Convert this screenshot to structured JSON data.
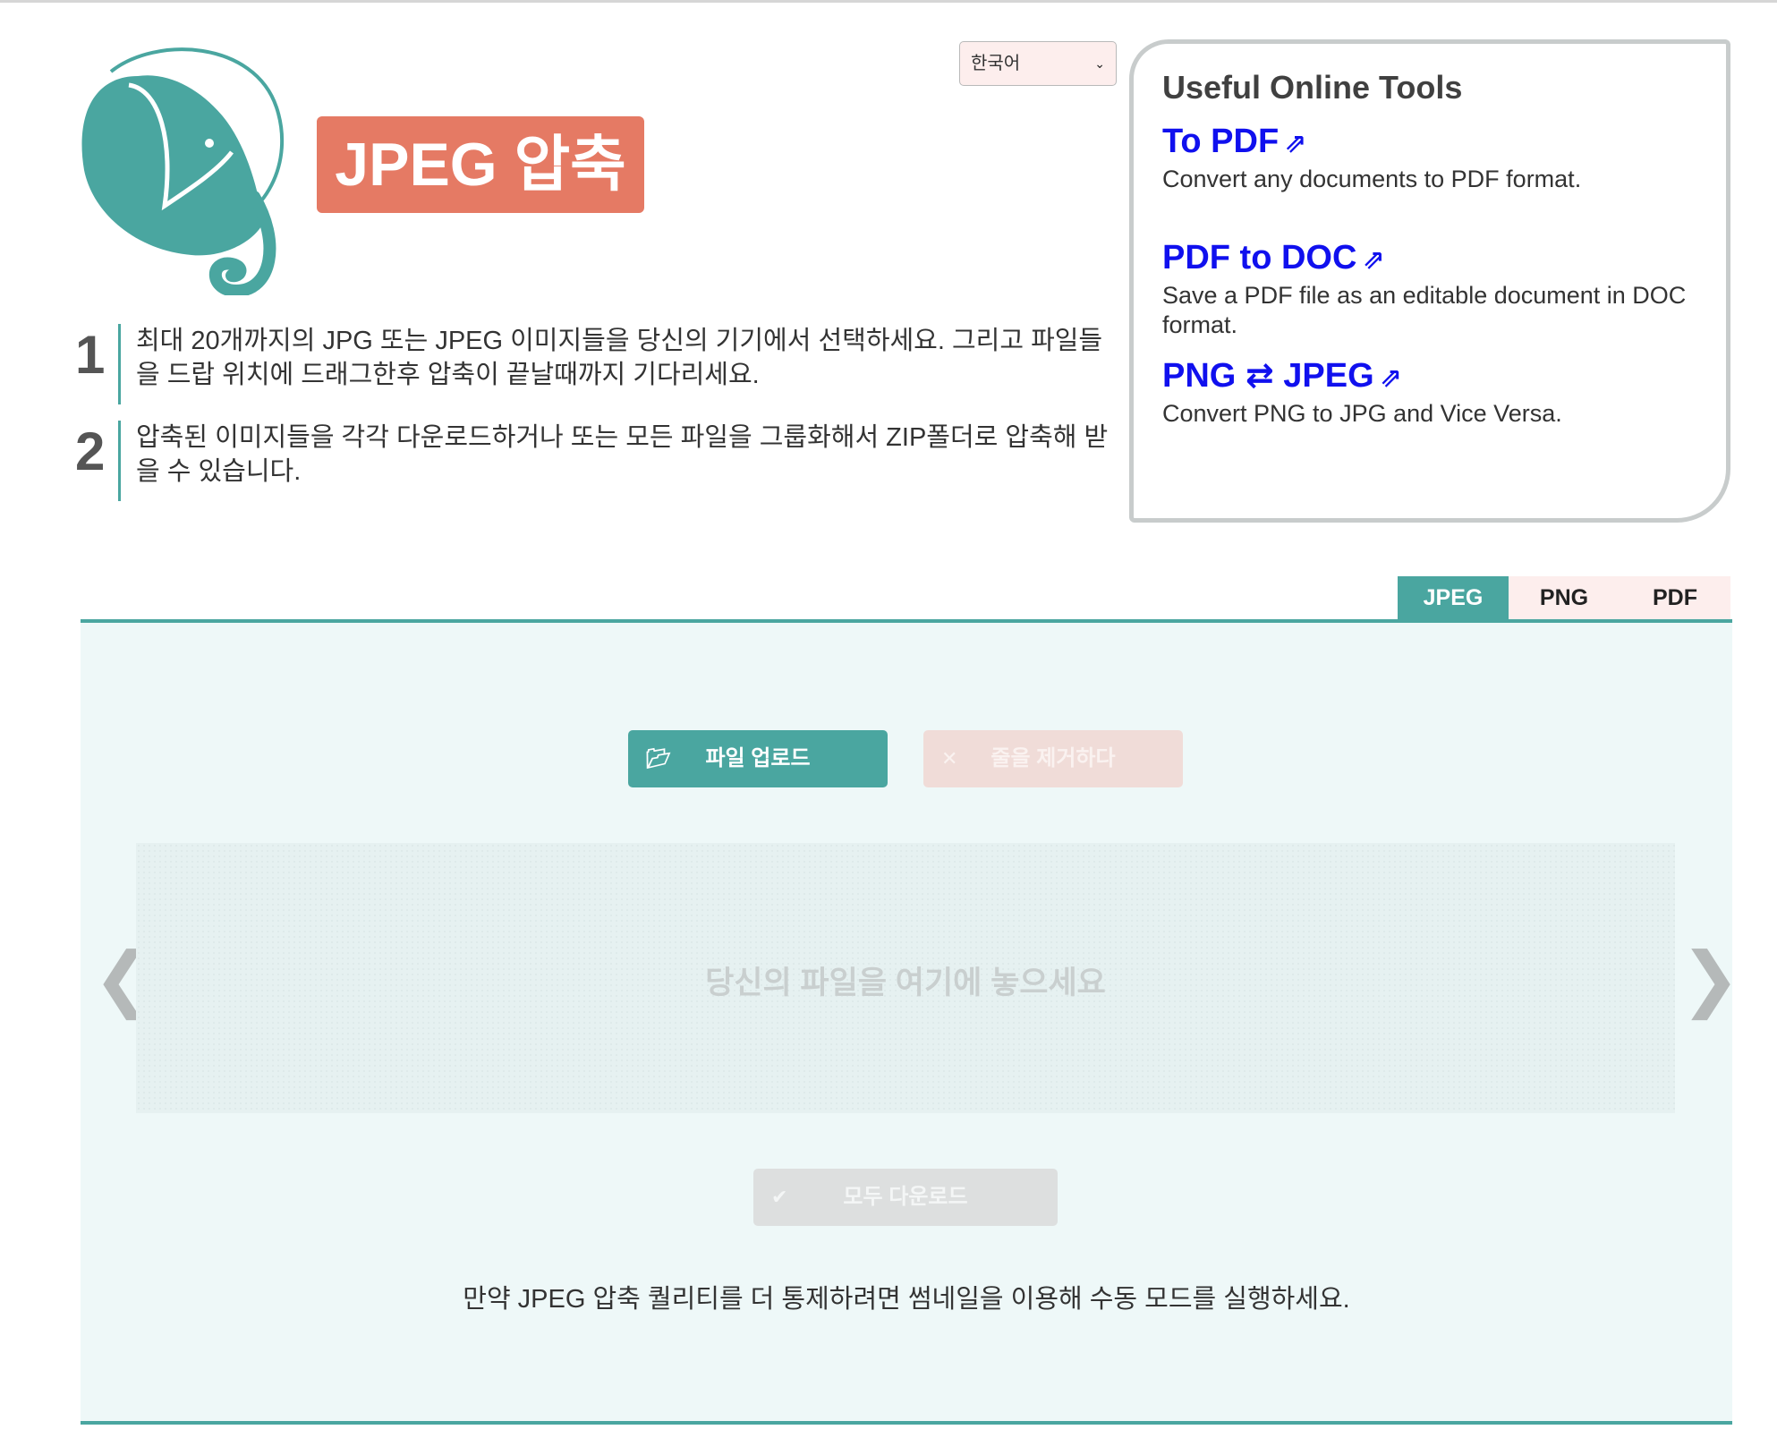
{
  "header": {
    "title": "JPEG 압축",
    "language": "한국어"
  },
  "steps": [
    {
      "number": "1",
      "text": "최대 20개까지의 JPG 또는 JPEG 이미지들을 당신의 기기에서 선택하세요. 그리고 파일들을 드랍 위치에 드래그한후 압축이 끝날때까지 기다리세요."
    },
    {
      "number": "2",
      "text": "압축된 이미지들을 각각 다운로드하거나 또는 모든 파일을 그룹화해서 ZIP폴더로 압축해 받을 수 있습니다."
    }
  ],
  "tools": {
    "title": "Useful Online Tools",
    "items": [
      {
        "label": "To PDF",
        "arrow": "⇗",
        "desc": "Convert any documents to PDF format."
      },
      {
        "label": "PDF to DOC",
        "arrow": "⇗",
        "desc": "Save a PDF file as an editable document in DOC format."
      },
      {
        "label": "PNG ⇄ JPEG",
        "arrow": "⇗",
        "desc": "Convert PNG to JPG and Vice Versa."
      }
    ]
  },
  "tabs": [
    "JPEG",
    "PNG",
    "PDF"
  ],
  "active_tab": "JPEG",
  "actions": {
    "upload_label": "파일 업로드",
    "upload_icon": "folder-open-icon",
    "remove_label": "줄을 제거하다",
    "remove_icon": "close-icon",
    "download_all_label": "모두 다운로드",
    "download_icon": "check-icon"
  },
  "dropzone": {
    "text": "당신의 파일을 여기에 놓으세요"
  },
  "hint": "만약 JPEG 압축 퀄리티를 더 통제하려면 썸네일을 이용해 수동 모드를 실행하세요.",
  "colors": {
    "accent": "#4aa6a0",
    "title_badge": "#e57a64",
    "link": "#1010ee",
    "panel_bg": "#eef8f8",
    "tab_bg": "#fdeeed"
  }
}
